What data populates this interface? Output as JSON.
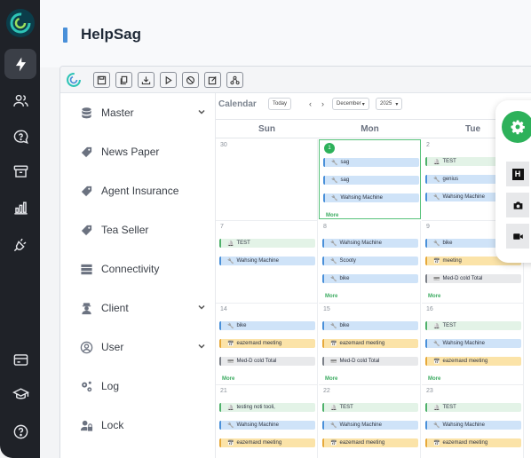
{
  "header": {
    "title": "HelpSag"
  },
  "rail": {
    "icons": [
      "bolt-icon",
      "users-icon",
      "chat-icon",
      "archive-icon",
      "bar-chart-icon",
      "plug-icon",
      "card-icon",
      "graduation-icon",
      "help-icon"
    ]
  },
  "toolbar": {
    "icons": [
      "save-icon",
      "copy-icon",
      "download-icon",
      "play-icon",
      "block-icon",
      "edit-icon",
      "hierarchy-icon"
    ]
  },
  "menu": {
    "items": [
      {
        "label": "Master",
        "icon": "database-icon",
        "has_children": true
      },
      {
        "label": "News Paper",
        "icon": "tag-icon",
        "has_children": false
      },
      {
        "label": "Agent Insurance",
        "icon": "tag-icon",
        "has_children": false
      },
      {
        "label": "Tea Seller",
        "icon": "tag-icon",
        "has_children": false
      },
      {
        "label": "Connectivity",
        "icon": "server-icon",
        "has_children": false
      },
      {
        "label": "Client",
        "icon": "agent-icon",
        "has_children": true
      },
      {
        "label": "User",
        "icon": "user-circle-icon",
        "has_children": true
      },
      {
        "label": "Log",
        "icon": "gears-icon",
        "has_children": false
      },
      {
        "label": "Lock",
        "icon": "user-lock-icon",
        "has_children": false
      }
    ]
  },
  "calendar": {
    "title": "Calendar",
    "today_label": "Today",
    "month": "December",
    "year": "2025",
    "days": [
      "Sun",
      "Mon",
      "Tue"
    ],
    "more_label": "More",
    "rows": [
      [
        {
          "date": "30",
          "events": []
        },
        {
          "date": "1",
          "today": true,
          "events": [
            {
              "text": "sag",
              "color": "blue",
              "icon": "wrench"
            },
            {
              "text": "sag",
              "color": "blue",
              "icon": "wrench"
            },
            {
              "text": "Wahsing Machine",
              "color": "blue",
              "icon": "wrench"
            }
          ],
          "more": true
        },
        {
          "date": "2",
          "events": [
            {
              "text": "TEST",
              "color": "green",
              "icon": "bell"
            },
            {
              "text": "genius",
              "color": "blue",
              "icon": "wrench"
            },
            {
              "text": "Wahsing Machine",
              "color": "blue",
              "icon": "wrench"
            }
          ]
        }
      ],
      [
        {
          "date": "7",
          "events": [
            {
              "text": "TEST",
              "color": "green",
              "icon": "bell"
            },
            {
              "text": "Wahsing Machine",
              "color": "blue",
              "icon": "wrench"
            }
          ]
        },
        {
          "date": "8",
          "events": [
            {
              "text": "Wahsing Machine",
              "color": "blue",
              "icon": "wrench"
            },
            {
              "text": "Scooty",
              "color": "blue",
              "icon": "wrench"
            },
            {
              "text": "bike",
              "color": "blue",
              "icon": "wrench"
            }
          ],
          "more": true
        },
        {
          "date": "9",
          "events": [
            {
              "text": "bike",
              "color": "blue",
              "icon": "wrench"
            },
            {
              "text": "meeting",
              "color": "yellow",
              "icon": "calendar"
            },
            {
              "text": "Med-D cold Total",
              "color": "gray",
              "icon": "card"
            }
          ],
          "more": true
        }
      ],
      [
        {
          "date": "14",
          "events": [
            {
              "text": "bike",
              "color": "blue",
              "icon": "wrench"
            },
            {
              "text": "eazemaxd meeting",
              "color": "yellow",
              "icon": "calendar"
            },
            {
              "text": "Med-D cold Total",
              "color": "gray",
              "icon": "card"
            }
          ],
          "more": true
        },
        {
          "date": "15",
          "events": [
            {
              "text": "bike",
              "color": "blue",
              "icon": "wrench"
            },
            {
              "text": "eazemaxd meeting",
              "color": "yellow",
              "icon": "calendar"
            },
            {
              "text": "Med-D cold Total",
              "color": "gray",
              "icon": "card"
            }
          ],
          "more": true
        },
        {
          "date": "16",
          "events": [
            {
              "text": "TEST",
              "color": "green",
              "icon": "bell"
            },
            {
              "text": "Wahsing Machine",
              "color": "blue",
              "icon": "wrench"
            },
            {
              "text": "eazemaxd meeting",
              "color": "yellow",
              "icon": "calendar"
            }
          ],
          "more": true
        }
      ],
      [
        {
          "date": "21",
          "events": [
            {
              "text": "testing noti tooli,",
              "color": "green",
              "icon": "bell"
            },
            {
              "text": "Wahsing Machine",
              "color": "blue",
              "icon": "wrench"
            },
            {
              "text": "eazemaxd meeting",
              "color": "yellow",
              "icon": "calendar"
            }
          ],
          "more": true
        },
        {
          "date": "22",
          "events": [
            {
              "text": "TEST",
              "color": "green",
              "icon": "bell"
            },
            {
              "text": "Wahsing Machine",
              "color": "blue",
              "icon": "wrench"
            },
            {
              "text": "eazemaxd meeting",
              "color": "yellow",
              "icon": "calendar"
            }
          ]
        },
        {
          "date": "23",
          "events": [
            {
              "text": "TEST",
              "color": "green",
              "icon": "bell"
            },
            {
              "text": "Wahsing Machine",
              "color": "blue",
              "icon": "wrench"
            },
            {
              "text": "eazemaxd meeting",
              "color": "yellow",
              "icon": "calendar"
            }
          ]
        }
      ]
    ]
  },
  "floating": {
    "gear_icon": "gear-icon",
    "buttons": [
      {
        "label": "H",
        "icon": "h-icon"
      },
      {
        "label": "",
        "icon": "camera-icon"
      },
      {
        "label": "",
        "icon": "video-icon"
      }
    ]
  },
  "colors": {
    "rail": "#1f2228",
    "accent_green": "#2db15a",
    "accent_blue": "#4a90d9"
  }
}
